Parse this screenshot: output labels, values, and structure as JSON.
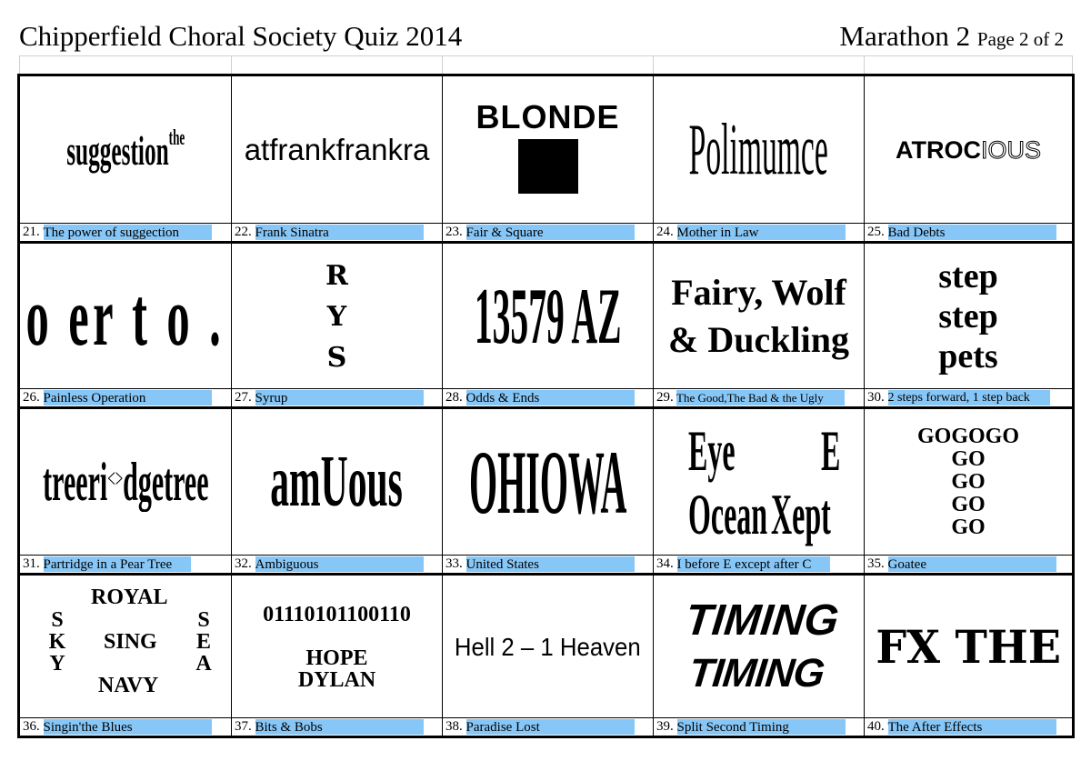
{
  "header": {
    "title": "Chipperfield Choral Society Quiz 2014",
    "round": "Marathon 2",
    "page": "Page 2 of 2"
  },
  "colors": {
    "answer_highlight": "#87c7f7",
    "grid_line": "#000000"
  },
  "puzzles": [
    {
      "number": "21.",
      "answer": "The power of suggection",
      "clue": {
        "main": "suggestion",
        "sup": "the"
      }
    },
    {
      "number": "22.",
      "answer": "Frank Sinatra",
      "clue": {
        "text": "atfrankfrankra"
      }
    },
    {
      "number": "23.",
      "answer": "Fair & Square",
      "clue": {
        "text": "BLONDE",
        "shape": "black-square"
      }
    },
    {
      "number": "24.",
      "answer": "Mother in Law",
      "clue": {
        "text": "Polimumce"
      }
    },
    {
      "number": "25.",
      "answer": "Bad Debts",
      "clue": {
        "solid": "ATROC",
        "outline": "IOUS"
      }
    },
    {
      "number": "26.",
      "answer": "Painless Operation",
      "clue": {
        "text": "o er t o ."
      }
    },
    {
      "number": "27.",
      "answer": "Syrup",
      "clue": {
        "lines": [
          "R",
          "Y",
          "S"
        ]
      }
    },
    {
      "number": "28.",
      "answer": "Odds & Ends",
      "clue": {
        "text": "13579 AZ"
      }
    },
    {
      "number": "29.",
      "answer": "The Good,The Bad & the Ugly",
      "clue": {
        "lines": [
          "Fairy, Wolf",
          "& Duckling"
        ]
      }
    },
    {
      "number": "30.",
      "answer": "2 steps forward, 1 step back",
      "clue": {
        "lines": [
          "step",
          "step",
          "pets"
        ]
      }
    },
    {
      "number": "31.",
      "answer": "Partridge in a Pear Tree",
      "clue": {
        "before": "treeri",
        "arrows": "<>",
        "after": "dgetree"
      }
    },
    {
      "number": "32.",
      "answer": "Ambiguous",
      "clue": {
        "text": "amUous"
      }
    },
    {
      "number": "33.",
      "answer": "United States",
      "clue": {
        "text": "OHIOWA"
      }
    },
    {
      "number": "34.",
      "answer": "I before E except after C",
      "clue": {
        "eye": "Eye",
        "e": "E",
        "ocean": "Ocean",
        "xept": "Xept"
      }
    },
    {
      "number": "35.",
      "answer": "Goatee",
      "clue": {
        "lines": [
          "GOGOGO",
          "GO",
          "GO",
          "GO",
          "GO"
        ]
      }
    },
    {
      "number": "36.",
      "answer": "Singin'the Blues",
      "clue": {
        "top": "ROYAL",
        "middle": "SING",
        "bottom": "NAVY",
        "left": [
          "S",
          "K",
          "Y"
        ],
        "right": [
          "S",
          "E",
          "A"
        ]
      }
    },
    {
      "number": "37.",
      "answer": "Bits & Bobs",
      "clue": {
        "binary": "01110101100110",
        "names": [
          "HOPE",
          "DYLAN"
        ]
      }
    },
    {
      "number": "38.",
      "answer": "Paradise Lost",
      "clue": {
        "text": "Hell 2 – 1 Heaven"
      }
    },
    {
      "number": "39.",
      "answer": "Split Second Timing",
      "clue": {
        "lines": [
          "TIMING",
          "TIMING"
        ]
      }
    },
    {
      "number": "40.",
      "answer": "The After Effects",
      "clue": {
        "text": "FX THE"
      }
    }
  ]
}
